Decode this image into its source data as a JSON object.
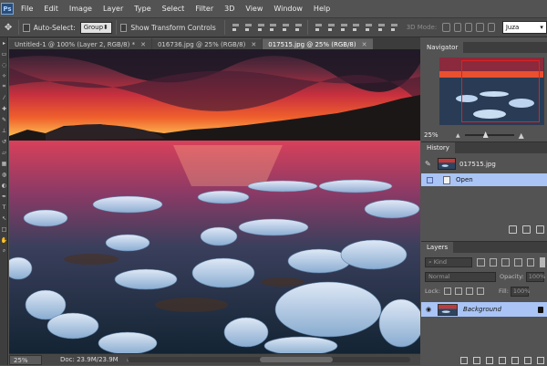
{
  "app": {
    "logo": "Ps"
  },
  "menu": [
    "File",
    "Edit",
    "Image",
    "Layer",
    "Type",
    "Select",
    "Filter",
    "3D",
    "View",
    "Window",
    "Help"
  ],
  "options": {
    "auto_select_label": "Auto-Select:",
    "auto_select_value": "Group",
    "transform_label": "Show Transform Controls",
    "mode3d_label": "3D Mode:",
    "workspace_value": "Juza"
  },
  "tabs": [
    {
      "label": "Untitled-1 @ 100% (Layer 2, RGB/8) *",
      "active": false
    },
    {
      "label": "016736.jpg @ 25% (RGB/8)",
      "active": false
    },
    {
      "label": "017515.jpg @ 25% (RGB/8)",
      "active": true
    }
  ],
  "status": {
    "zoom": "25%",
    "doc_info": "Doc: 23.9M/23.9M"
  },
  "navigator": {
    "title": "Navigator",
    "zoom": "25%"
  },
  "history": {
    "title": "History",
    "snapshot_name": "017515.jpg",
    "state_label": "Open"
  },
  "layers": {
    "title": "Layers",
    "kind_label": "Kind",
    "blend_mode": "Normal",
    "opacity_label": "Opacity:",
    "opacity_value": "100%",
    "lock_label": "Lock:",
    "fill_label": "Fill:",
    "fill_value": "100%",
    "layer_name": "Background"
  },
  "colors": {
    "selection": "#a9c4f5",
    "panel_bg": "#535353",
    "nav_view_box": "#e02020"
  }
}
